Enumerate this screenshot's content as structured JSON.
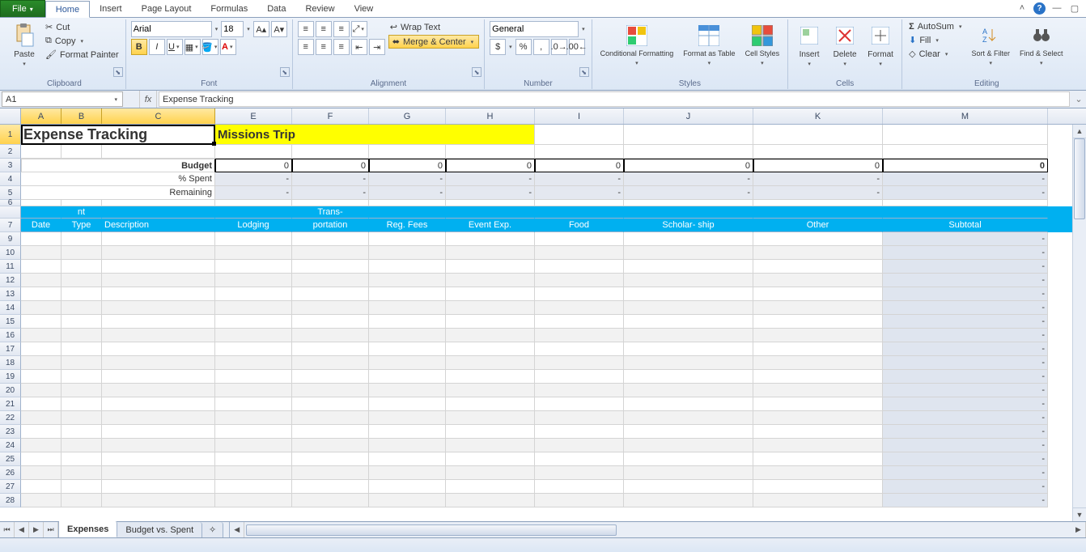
{
  "menu": {
    "file": "File",
    "tabs": [
      "Home",
      "Insert",
      "Page Layout",
      "Formulas",
      "Data",
      "Review",
      "View"
    ],
    "active": "Home"
  },
  "ribbon": {
    "clipboard": {
      "paste": "Paste",
      "cut": "Cut",
      "copy": "Copy",
      "fmt": "Format Painter",
      "label": "Clipboard"
    },
    "font": {
      "name": "Arial",
      "size": "18",
      "bold": "B",
      "italic": "I",
      "underline": "U",
      "label": "Font"
    },
    "alignment": {
      "wrap": "Wrap Text",
      "merge": "Merge & Center",
      "label": "Alignment"
    },
    "number": {
      "format": "General",
      "currency": "$",
      "percent": "%",
      "comma": ",",
      "inc": ".0",
      "dec": ".00",
      "label": "Number"
    },
    "styles": {
      "cond": "Conditional Formatting",
      "table": "Format as Table",
      "cell": "Cell Styles",
      "label": "Styles"
    },
    "cells": {
      "insert": "Insert",
      "delete": "Delete",
      "format": "Format",
      "label": "Cells"
    },
    "editing": {
      "autosum": "AutoSum",
      "fill": "Fill",
      "clear": "Clear",
      "sort": "Sort & Filter",
      "find": "Find & Select",
      "label": "Editing"
    }
  },
  "formula_bar": {
    "name": "A1",
    "fx": "fx",
    "value": "Expense Tracking"
  },
  "columns": [
    "A",
    "B",
    "C",
    "E",
    "F",
    "G",
    "H",
    "I",
    "J",
    "K",
    "M"
  ],
  "sheet": {
    "r1": {
      "title": "Expense Tracking",
      "subtitle": "Missions Trip"
    },
    "r3": {
      "label": "Budget",
      "vals": [
        "0",
        "0",
        "0",
        "0",
        "0",
        "0",
        "0",
        "0"
      ]
    },
    "r4": {
      "label": "% Spent",
      "vals": [
        "-",
        "-",
        "-",
        "-",
        "-",
        "-",
        "-",
        "-"
      ]
    },
    "r5": {
      "label": "Remaining",
      "vals": [
        "-",
        "-",
        "-",
        "-",
        "-",
        "-",
        "-",
        "-"
      ]
    },
    "hdr_top": {
      "b": "nt",
      "f": "Trans-"
    },
    "hdr": {
      "a": "Date",
      "b": "Type",
      "c": "Description",
      "e": "Lodging",
      "f": "portation",
      "g": "Reg. Fees",
      "h": "Event Exp.",
      "i": "Food",
      "j": "Scholar- ship",
      "k": "Other",
      "m": "Subtotal"
    },
    "dash": "-"
  },
  "sheettabs": {
    "tabs": [
      "Expenses",
      "Budget vs. Spent"
    ],
    "active": "Expenses"
  }
}
